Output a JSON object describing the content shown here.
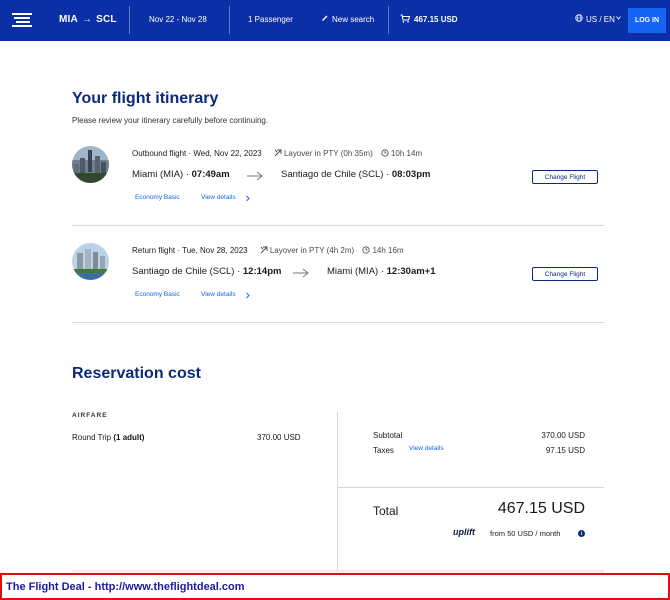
{
  "header": {
    "origin": "MIA",
    "destination": "SCL",
    "dates": "Nov 22 - Nov 28",
    "passengers": "1 Passenger",
    "new_search": "New search",
    "cart_total": "467.15 USD",
    "locale": "US / EN",
    "login": "LOG IN",
    "colors": {
      "bar": "#0b2fa6",
      "button": "#1565f2"
    }
  },
  "itinerary": {
    "title": "Your flight itinerary",
    "subtitle": "Please review your itinerary carefully before continuing.",
    "flights": [
      {
        "label": "Outbound flight · Wed, Nov 22, 2023",
        "layover": "Layover in PTY (0h 35m)",
        "duration": "10h 14m",
        "from_city": "Miami (MIA) · ",
        "from_time": "07:49am",
        "to_city": "Santiago de Chile (SCL) · ",
        "to_time": "08:03pm",
        "fare": "Economy Basic",
        "details": "View details",
        "change": "Change Flight"
      },
      {
        "label": "Return flight · Tue, Nov 28, 2023",
        "layover": "Layover in PTY (4h 2m)",
        "duration": "14h 16m",
        "from_city": "Santiago de Chile (SCL) · ",
        "from_time": "12:14pm",
        "to_city": "Miami (MIA) · ",
        "to_time": "12:30am+1",
        "fare": "Economy Basic",
        "details": "View details",
        "change": "Change Flight"
      }
    ]
  },
  "cost": {
    "title": "Reservation cost",
    "airfare_label": "AIRFARE",
    "trip_type_prefix": "Round Trip ",
    "trip_type_bold": "(1 adult)",
    "trip_amount": "370.00 USD",
    "subtotal_label": "Subtotal",
    "subtotal_value": "370.00 USD",
    "taxes_label": "Taxes",
    "taxes_link": "View details",
    "taxes_value": "97.15 USD",
    "total_label": "Total",
    "total_value": "467.15 USD",
    "uplift_brand": "uplift",
    "uplift_text": "from 50 USD  / month",
    "info": "i"
  },
  "banner": {
    "text": "The Flight Deal - http://www.theflightdeal.com",
    "border_color": "#e01010"
  }
}
